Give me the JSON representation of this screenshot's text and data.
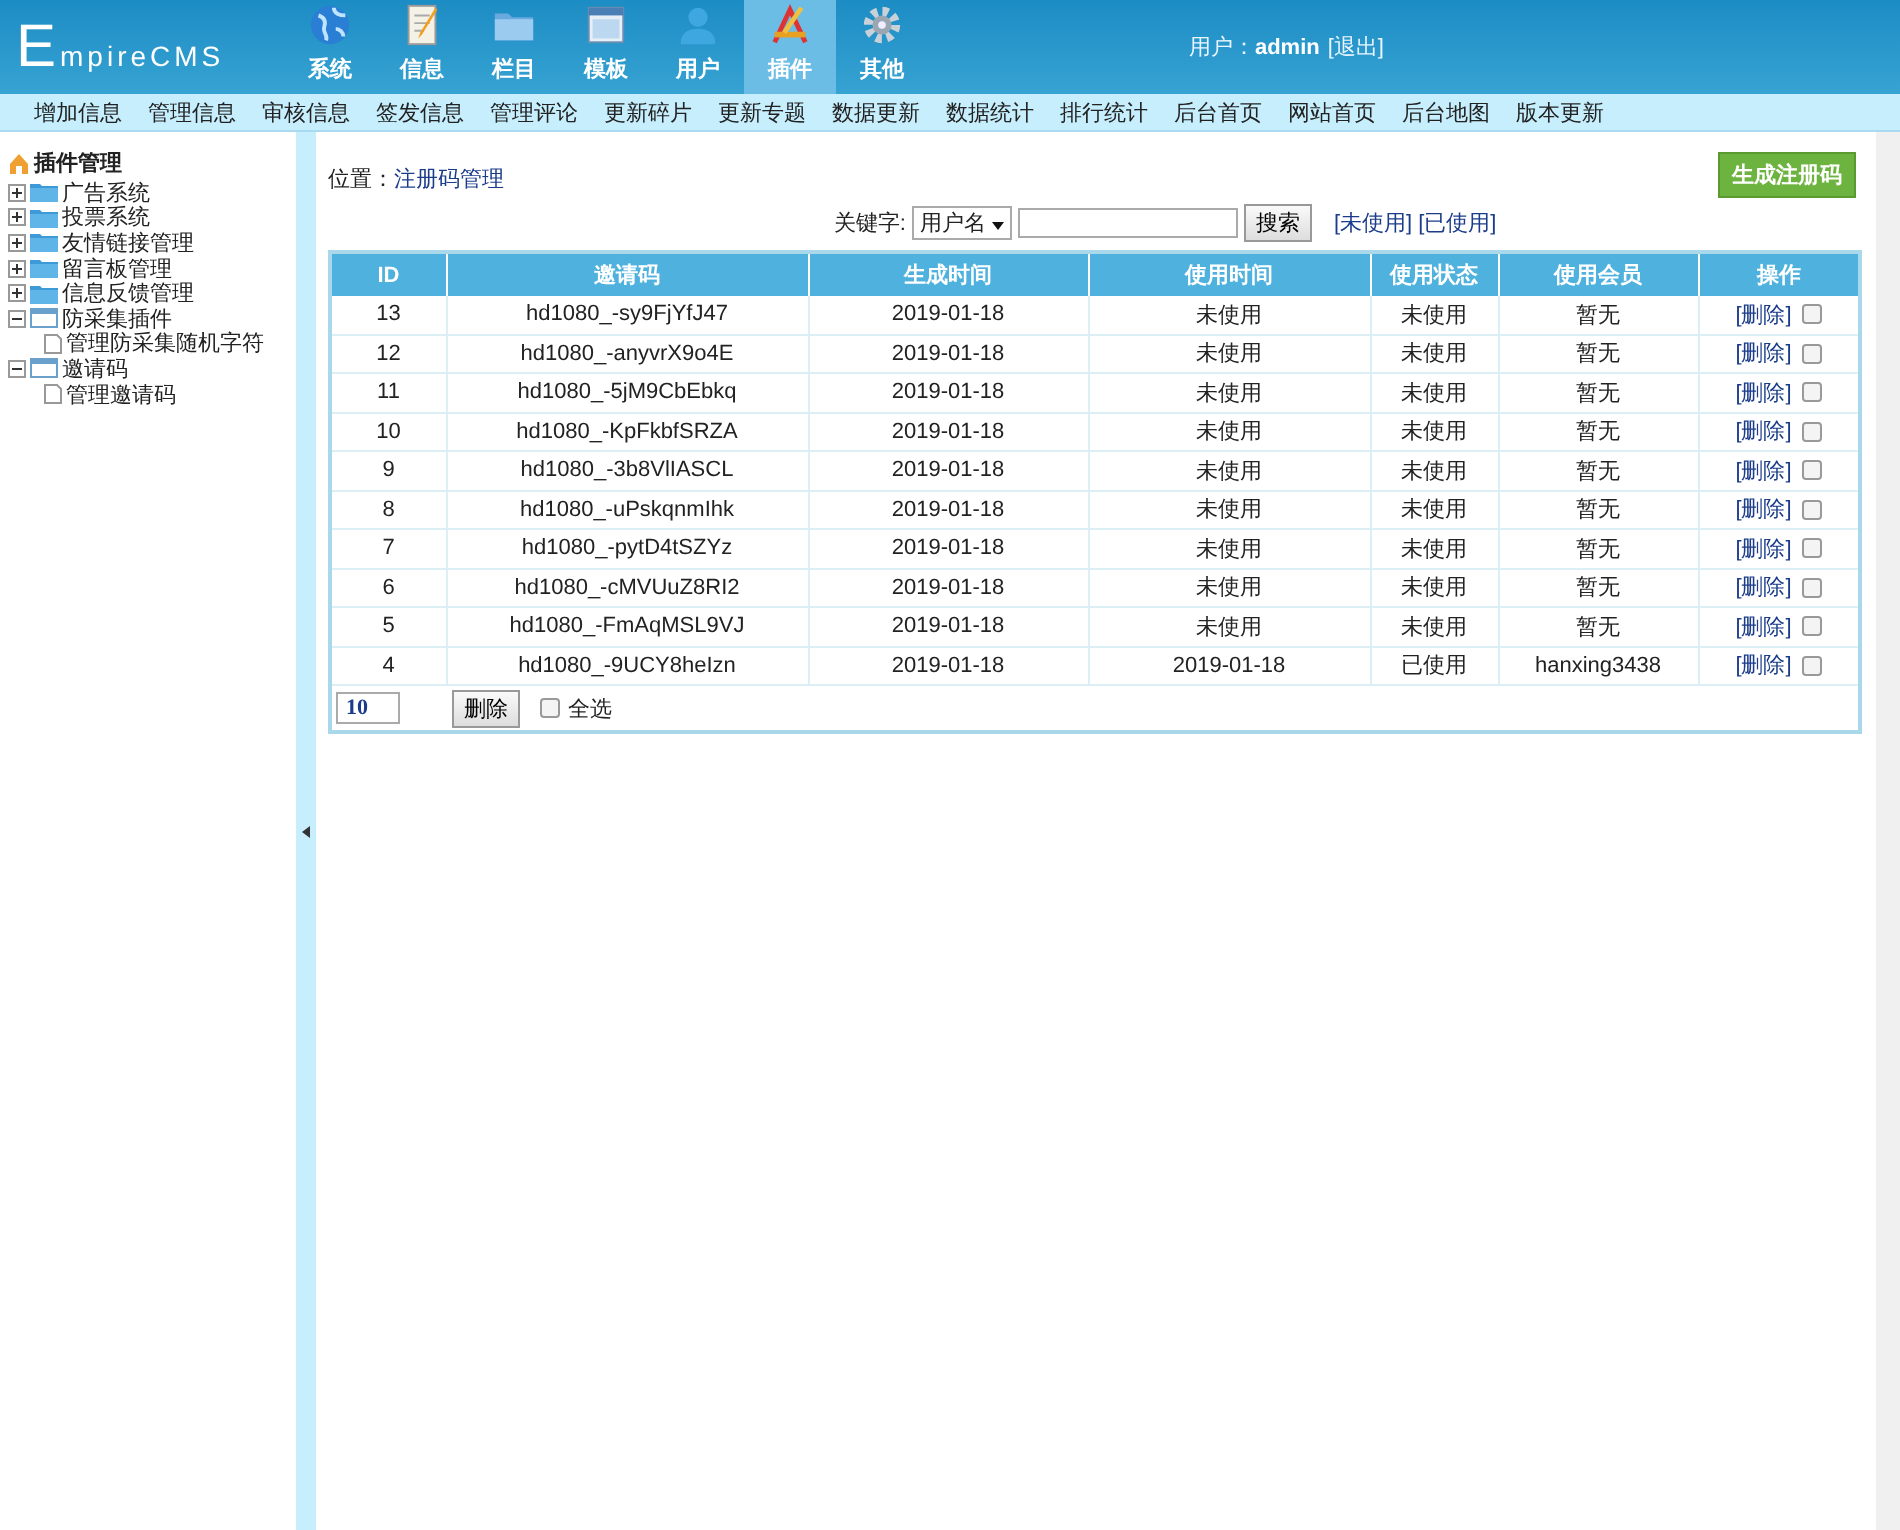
{
  "header": {
    "logo": "EmpireCMS",
    "nav": [
      {
        "label": "系统",
        "kind": "globe",
        "selected": false
      },
      {
        "label": "信息",
        "kind": "document",
        "selected": false
      },
      {
        "label": "栏目",
        "kind": "folder",
        "selected": false
      },
      {
        "label": "模板",
        "kind": "window",
        "selected": false
      },
      {
        "label": "用户",
        "kind": "person",
        "selected": false
      },
      {
        "label": "插件",
        "kind": "tools",
        "selected": true
      },
      {
        "label": "其他",
        "kind": "gear",
        "selected": false
      }
    ],
    "user": {
      "label": "用户：",
      "name": "admin",
      "logout": "[退出]"
    }
  },
  "menu": [
    "增加信息",
    "管理信息",
    "审核信息",
    "签发信息",
    "管理评论",
    "更新碎片",
    "更新专题",
    "数据更新",
    "数据统计",
    "排行统计",
    "后台首页",
    "网站首页",
    "后台地图",
    "版本更新"
  ],
  "sidebar": {
    "title": "插件管理",
    "items": [
      {
        "label": "广告系统",
        "expanded": false
      },
      {
        "label": "投票系统",
        "expanded": false
      },
      {
        "label": "友情链接管理",
        "expanded": false
      },
      {
        "label": "留言板管理",
        "expanded": false
      },
      {
        "label": "信息反馈管理",
        "expanded": false
      },
      {
        "label": "防采集插件",
        "expanded": true,
        "children": [
          {
            "label": "管理防采集随机字符"
          }
        ]
      },
      {
        "label": "邀请码",
        "expanded": true,
        "children": [
          {
            "label": "管理邀请码"
          }
        ]
      }
    ]
  },
  "breadcrumb": {
    "label": "位置：",
    "link": "注册码管理"
  },
  "generate_button": "生成注册码",
  "search": {
    "label": "关键字:",
    "select": "用户名",
    "button": "搜索",
    "filters": [
      "[未使用]",
      "[已使用]"
    ]
  },
  "table": {
    "columns": [
      "ID",
      "邀请码",
      "生成时间",
      "使用时间",
      "使用状态",
      "使用会员",
      "操作"
    ],
    "rows": [
      {
        "cells": [
          "13",
          "hd1080_-sy9FjYfJ47",
          "2019-01-18",
          "未使用",
          "未使用",
          "暂无"
        ],
        "action": "[删除]",
        "checked": false
      },
      {
        "cells": [
          "12",
          "hd1080_-anyvrX9o4E",
          "2019-01-18",
          "未使用",
          "未使用",
          "暂无"
        ],
        "action": "[删除]",
        "checked": false
      },
      {
        "cells": [
          "11",
          "hd1080_-5jM9CbEbkq",
          "2019-01-18",
          "未使用",
          "未使用",
          "暂无"
        ],
        "action": "[删除]",
        "checked": false
      },
      {
        "cells": [
          "10",
          "hd1080_-KpFkbfSRZA",
          "2019-01-18",
          "未使用",
          "未使用",
          "暂无"
        ],
        "action": "[删除]",
        "checked": false
      },
      {
        "cells": [
          "9",
          "hd1080_-3b8VlIASCL",
          "2019-01-18",
          "未使用",
          "未使用",
          "暂无"
        ],
        "action": "[删除]",
        "checked": false
      },
      {
        "cells": [
          "8",
          "hd1080_-uPskqnmIhk",
          "2019-01-18",
          "未使用",
          "未使用",
          "暂无"
        ],
        "action": "[删除]",
        "checked": false
      },
      {
        "cells": [
          "7",
          "hd1080_-pytD4tSZYz",
          "2019-01-18",
          "未使用",
          "未使用",
          "暂无"
        ],
        "action": "[删除]",
        "checked": false
      },
      {
        "cells": [
          "6",
          "hd1080_-cMVUuZ8RI2",
          "2019-01-18",
          "未使用",
          "未使用",
          "暂无"
        ],
        "action": "[删除]",
        "checked": false
      },
      {
        "cells": [
          "5",
          "hd1080_-FmAqMSL9VJ",
          "2019-01-18",
          "未使用",
          "未使用",
          "暂无"
        ],
        "action": "[删除]",
        "checked": false
      },
      {
        "cells": [
          "4",
          "hd1080_-9UCY8heIzn",
          "2019-01-18",
          "2019-01-18",
          "已使用",
          "hanxing3438"
        ],
        "action": "[删除]",
        "checked": false
      }
    ],
    "footer": {
      "page_size": "10",
      "delete_button": "删除",
      "select_all": {
        "label": "全选",
        "checked": false
      }
    }
  }
}
